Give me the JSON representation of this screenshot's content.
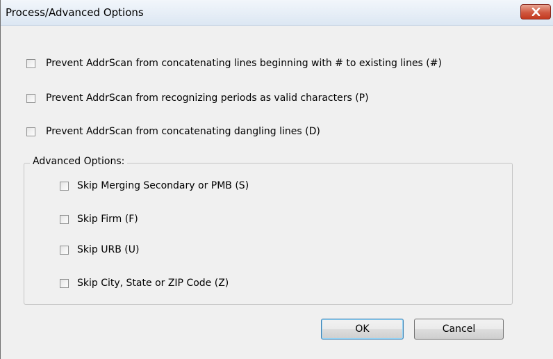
{
  "window": {
    "title": "Process/Advanced Options"
  },
  "options": [
    {
      "label": "Prevent AddrScan from concatenating lines beginning with # to existing lines (#)",
      "checked": false
    },
    {
      "label": "Prevent AddrScan from recognizing periods as valid characters (P)",
      "checked": false
    },
    {
      "label": "Prevent AddrScan from concatenating dangling lines (D)",
      "checked": false
    }
  ],
  "advanced": {
    "group_label": "Advanced Options:",
    "items": [
      {
        "label": "Skip Merging Secondary or PMB (S)",
        "checked": false
      },
      {
        "label": "Skip Firm (F)",
        "checked": false
      },
      {
        "label": "Skip URB (U)",
        "checked": false
      },
      {
        "label": "Skip City, State or ZIP Code (Z)",
        "checked": false
      }
    ]
  },
  "buttons": {
    "ok_label": "OK",
    "cancel_label": "Cancel"
  }
}
